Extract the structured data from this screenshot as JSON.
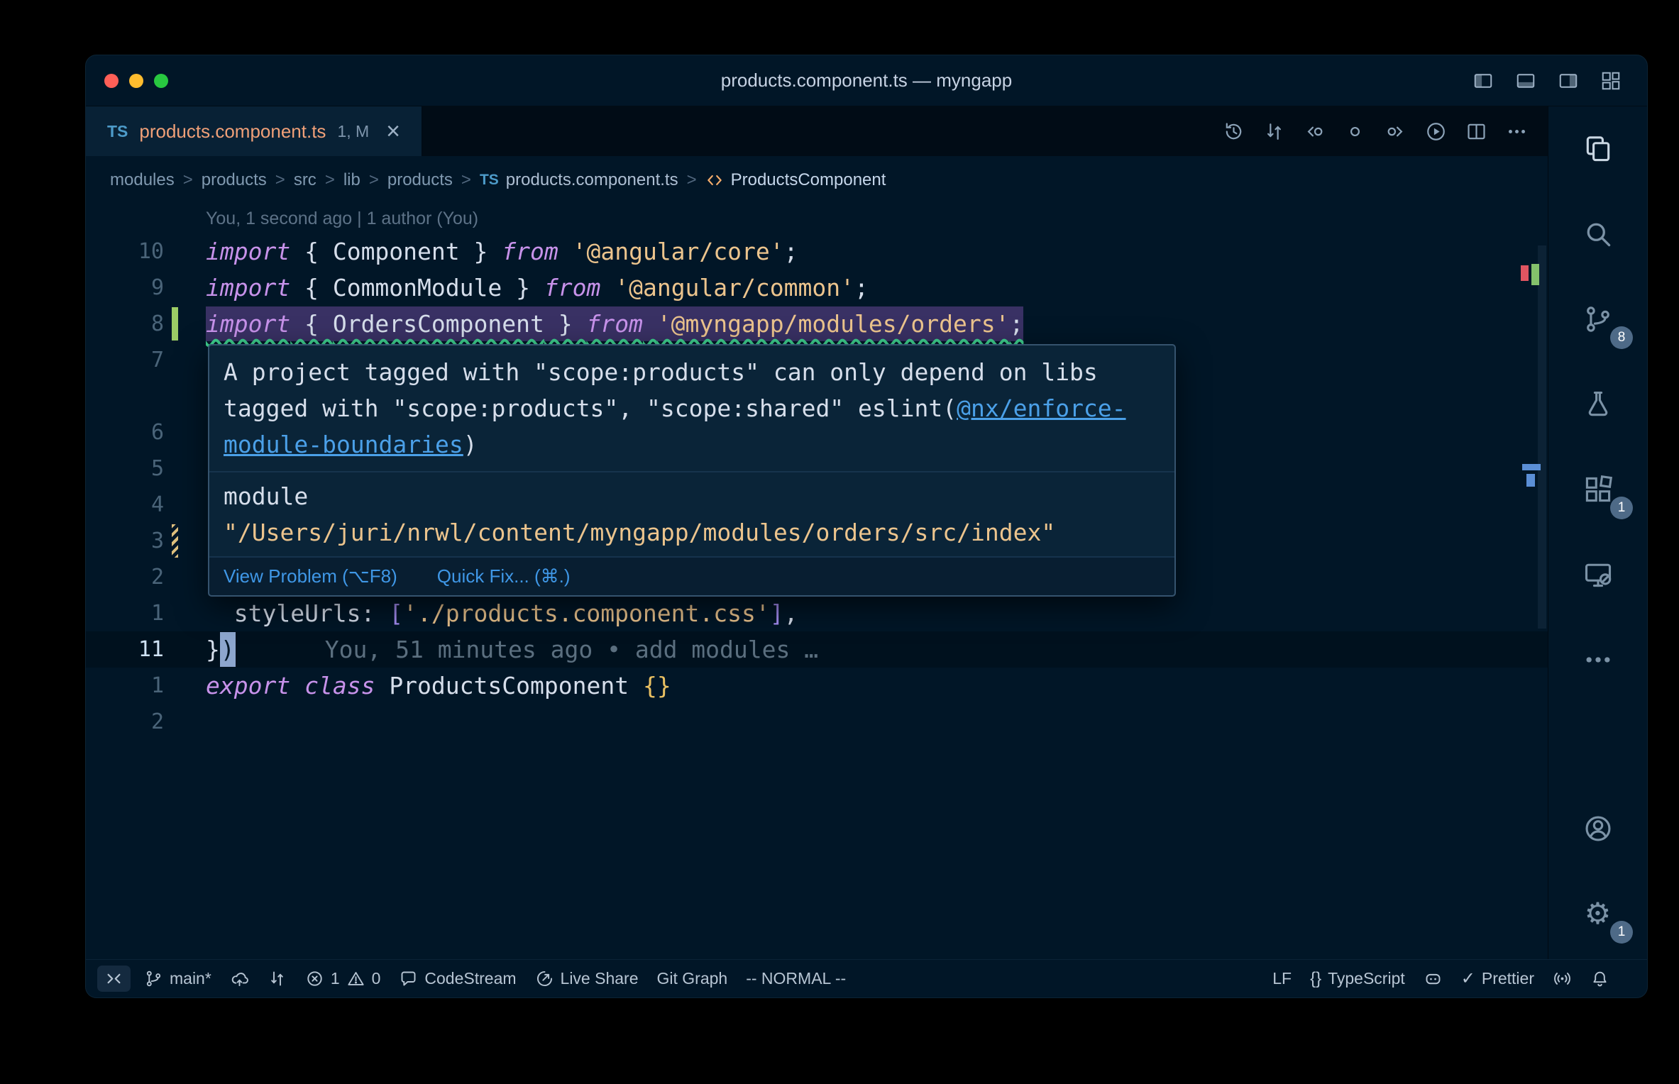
{
  "window": {
    "title": "products.component.ts — myngapp"
  },
  "tab": {
    "ts": "TS",
    "label": "products.component.ts",
    "badge": "1, M",
    "close": "×"
  },
  "breadcrumb": {
    "sep": ">",
    "ts_label": "TS",
    "items": [
      {
        "label": "modules"
      },
      {
        "label": "products"
      },
      {
        "label": "src"
      },
      {
        "label": "lib"
      },
      {
        "label": "products"
      },
      {
        "label": "products.component.ts"
      },
      {
        "label": "ProductsComponent"
      }
    ]
  },
  "editor": {
    "codelens": "You, 1 second ago | 1 author (You)",
    "lines": [
      {
        "n": "10",
        "tokens": [
          [
            "kw",
            "import"
          ],
          [
            "fg",
            " { "
          ],
          [
            "fg",
            "Component"
          ],
          [
            "fg",
            " } "
          ],
          [
            "kw",
            "from"
          ],
          [
            "fg",
            " "
          ],
          [
            "str",
            "'@angular/core'"
          ],
          [
            "fg",
            ";"
          ]
        ]
      },
      {
        "n": "9",
        "tokens": [
          [
            "kw",
            "import"
          ],
          [
            "fg",
            " { "
          ],
          [
            "fg",
            "CommonModule"
          ],
          [
            "fg",
            " } "
          ],
          [
            "kw",
            "from"
          ],
          [
            "fg",
            " "
          ],
          [
            "str",
            "'@angular/common'"
          ],
          [
            "fg",
            ";"
          ]
        ]
      },
      {
        "n": "8",
        "err": true,
        "g": "add",
        "tokens": [
          [
            "kw",
            "import"
          ],
          [
            "fg",
            " { "
          ],
          [
            "fg",
            "OrdersComponent"
          ],
          [
            "fg",
            " } "
          ],
          [
            "kw",
            "from"
          ],
          [
            "fg",
            " "
          ],
          [
            "str",
            "'@myngapp/modules/orders'"
          ],
          [
            "fg",
            ";"
          ]
        ]
      },
      {
        "n": "7",
        "tokens": []
      },
      {
        "n": "",
        "tokens": []
      },
      {
        "n": "6",
        "tokens": []
      },
      {
        "n": "5",
        "tokens": []
      },
      {
        "n": "4",
        "tokens": []
      },
      {
        "n": "3",
        "g": "mod",
        "tokens": []
      },
      {
        "n": "2",
        "tokens": []
      },
      {
        "n": "1",
        "tokens": [
          [
            "fg",
            "  styleUrls: "
          ],
          [
            "brk",
            "["
          ],
          [
            "str",
            "'./products.component.css'"
          ],
          [
            "brk",
            "]"
          ],
          [
            "fg",
            ","
          ]
        ]
      },
      {
        "n": "11",
        "cur": true,
        "blame": "You, 51 minutes ago • add modules …",
        "tokens": [
          [
            "fg",
            "}"
          ],
          [
            "cursor",
            ")"
          ]
        ]
      },
      {
        "n": "1",
        "tokens": [
          [
            "kw",
            "export"
          ],
          [
            "fg",
            " "
          ],
          [
            "kw",
            "class"
          ],
          [
            "fg",
            " "
          ],
          [
            "fg",
            "ProductsComponent"
          ],
          [
            "fg",
            " "
          ],
          [
            "gold",
            "{}"
          ]
        ]
      },
      {
        "n": "2",
        "tokens": []
      }
    ]
  },
  "hover": {
    "message_before": "A project tagged with \"scope:products\" can only depend on libs tagged with \"scope:products\", \"scope:shared\" eslint(",
    "message_link": "@nx/enforce-module-boundaries",
    "message_after": ")",
    "module_keyword": "module",
    "module_path": "\"/Users/juri/nrwl/content/myngapp/modules/orders/src/index\"",
    "view_problem": "View Problem (⌥F8)",
    "quick_fix": "Quick Fix... (⌘.)"
  },
  "activitybar": {
    "scm_badge": "8",
    "extensions_badge": "1",
    "settings_badge": "1"
  },
  "icons": {
    "gear": "⚙",
    "check": "✓",
    "braces": "{}"
  },
  "statusbar": {
    "branch": "main*",
    "errors": "1",
    "warnings": "0",
    "codestream": "CodeStream",
    "live_share": "Live Share",
    "git_graph": "Git Graph",
    "vim_mode": "-- NORMAL --",
    "eol": "LF",
    "language": "TypeScript",
    "prettier": "Prettier"
  }
}
